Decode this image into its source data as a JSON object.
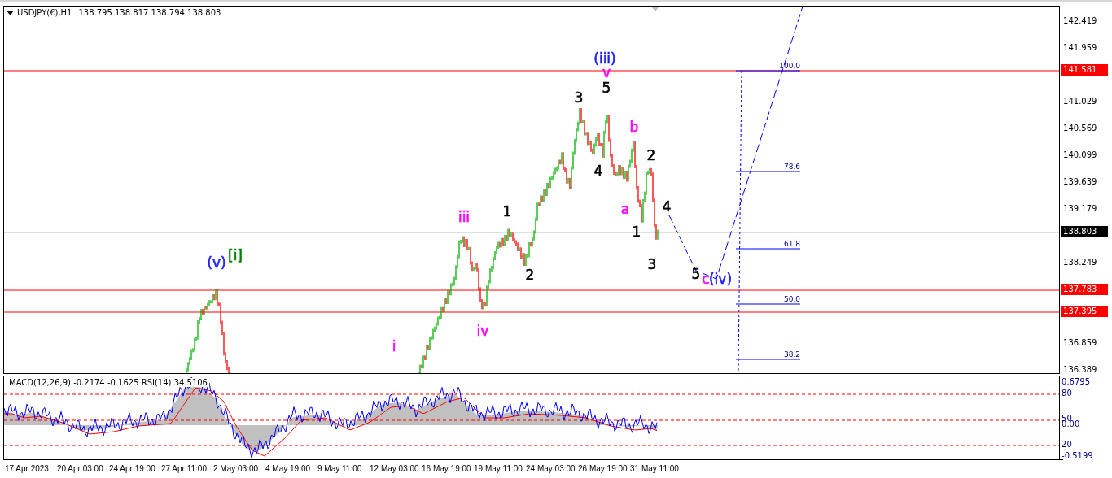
{
  "chart": {
    "symbol": "USDJPY(€),H1",
    "quote": "138.795 138.817 138.794 138.803",
    "wave_labels": [
      {
        "text": "(iii)",
        "color": "#1f1fff"
      },
      {
        "text": "v",
        "color": "#ff00ff"
      },
      {
        "text": "5",
        "color": "#000000"
      },
      {
        "text": "3",
        "color": "#000000"
      },
      {
        "text": "b",
        "color": "#ff00ff"
      },
      {
        "text": "2",
        "color": "#000000"
      },
      {
        "text": "4",
        "color": "#000000"
      },
      {
        "text": "a",
        "color": "#ff00ff"
      },
      {
        "text": "4",
        "color": "#000000"
      },
      {
        "text": "1",
        "color": "#000000"
      },
      {
        "text": "3",
        "color": "#000000"
      },
      {
        "text": "5",
        "color": "#000000"
      },
      {
        "text": "c",
        "color": "#ff00ff"
      },
      {
        "text": "(iv)",
        "color": "#1f1fff"
      },
      {
        "text": "1",
        "color": "#000000"
      },
      {
        "text": "iii",
        "color": "#ff00ff"
      },
      {
        "text": "2",
        "color": "#000000"
      },
      {
        "text": "iv",
        "color": "#ff00ff"
      },
      {
        "text": "i",
        "color": "#ff00ff"
      },
      {
        "text": "(v)",
        "color": "#1f1fff"
      },
      {
        "text": "[i]",
        "color": "#008000"
      }
    ],
    "fib_levels": [
      "100.0",
      "78.6",
      "61.8",
      "50.0",
      "38.2"
    ],
    "price_ticks": [
      "142.419",
      "141.959",
      "141.029",
      "140.569",
      "140.099",
      "139.639",
      "139.179",
      "138.249",
      "136.859",
      "136.389"
    ],
    "price_markers": [
      {
        "label": "141.581",
        "kind": "level",
        "color": "#ff0000"
      },
      {
        "label": "138.803",
        "kind": "bid",
        "color": "#000000"
      },
      {
        "label": "137.783",
        "kind": "level",
        "color": "#ff0000"
      },
      {
        "label": "137.395",
        "kind": "level",
        "color": "#ff0000"
      }
    ]
  },
  "indicator": {
    "title": "MACD(12,26,9) -0.2174 -0.1625  RSI(14) 34.5106",
    "ticks": [
      "0.6795",
      "80",
      "50",
      "0.00",
      "20",
      "-0.5199"
    ]
  },
  "time_axis": [
    "17 Apr 2023",
    "20 Apr 03:00",
    "24 Apr 19:00",
    "27 Apr 11:00",
    "2 May 03:00",
    "4 May 19:00",
    "9 May 11:00",
    "12 May 03:00",
    "16 May 19:00",
    "19 May 11:00",
    "24 May 03:00",
    "26 May 19:00",
    "31 May 11:00"
  ]
}
